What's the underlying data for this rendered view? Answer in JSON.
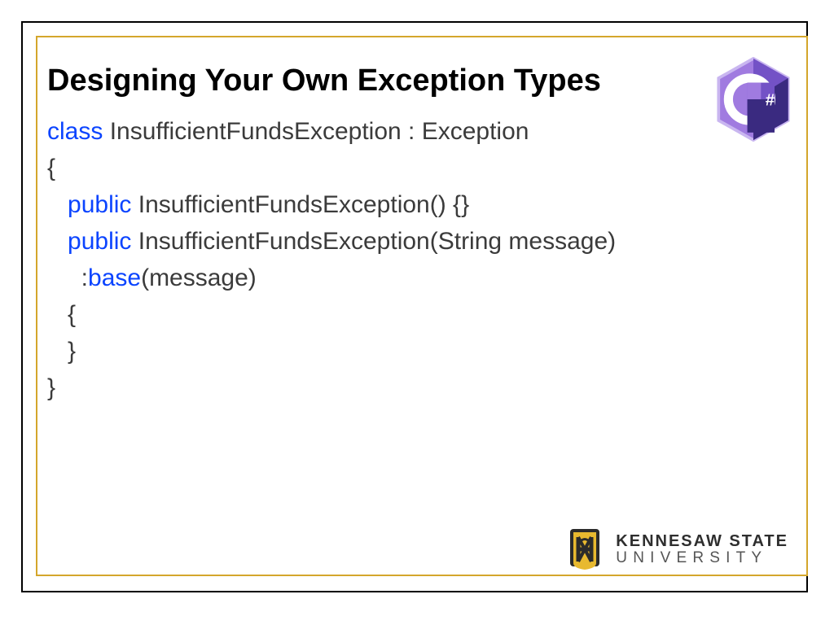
{
  "slide": {
    "title": "Designing Your Own Exception Types",
    "code": {
      "k_class": "class",
      "class_decl": " InsufficientFundsException : Exception",
      "open_brace": "{",
      "indent": "   ",
      "k_public1": "public",
      "ctor1": " InsufficientFundsException() {}",
      "k_public2": "public",
      "ctor2_sig": " InsufficientFundsException(String message)",
      "base_indent": "     :",
      "k_base": "base",
      "base_args": "(message)",
      "body_open": "   {",
      "body_close": "   }",
      "close_brace": "}"
    }
  },
  "icons": {
    "csharp": "C#"
  },
  "footer": {
    "org_line1": "KENNESAW STATE",
    "org_line2": "UNIVERSITY"
  },
  "colors": {
    "keyword": "#0b44ff",
    "gold": "#d4a62b",
    "csharp_purple": "#7352c6",
    "csharp_dark": "#3a2a80"
  }
}
